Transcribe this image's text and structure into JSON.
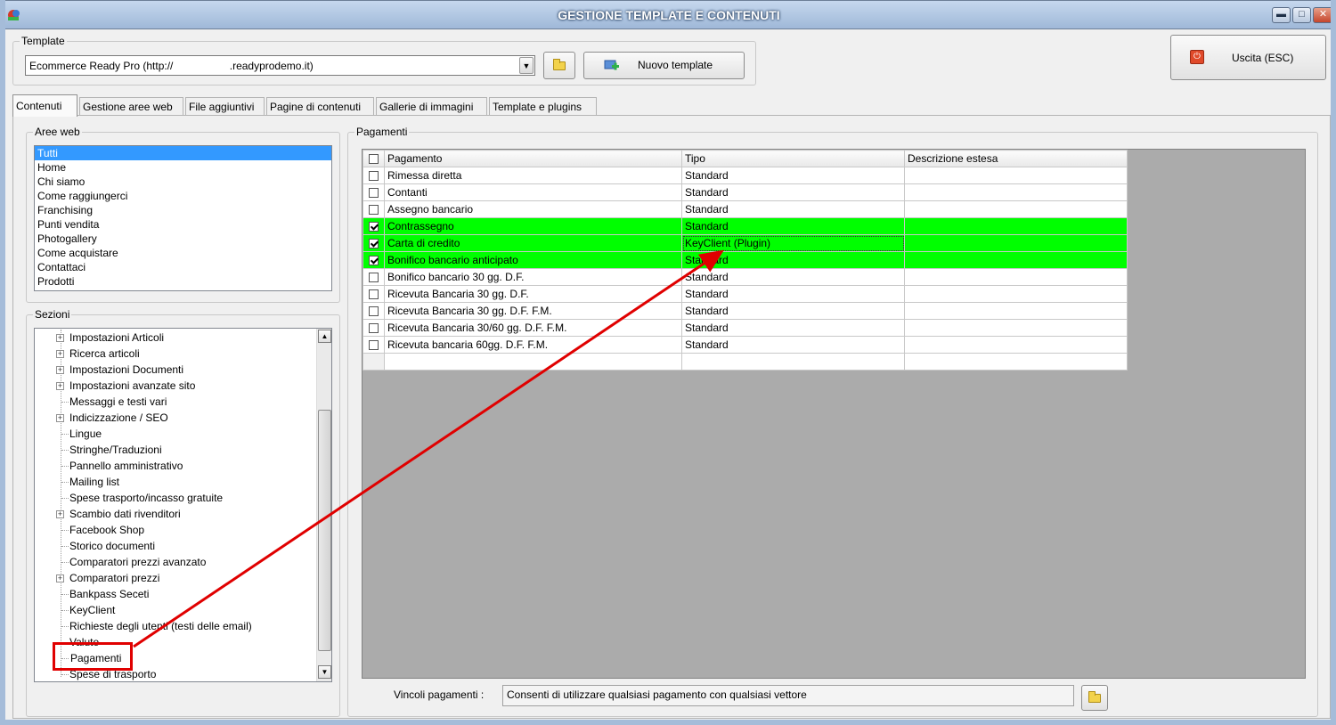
{
  "window": {
    "title": "GESTIONE TEMPLATE E CONTENUTI",
    "minimize": "▬",
    "maximize": "□",
    "close": "✕"
  },
  "template": {
    "group_label": "Template",
    "selected": "Ecommerce Ready Pro (http://                   .readyprodemo.it)",
    "new_button": "Nuovo template"
  },
  "exit_button": "Uscita (ESC)",
  "tabs": [
    {
      "label": "Contenuti",
      "active": true
    },
    {
      "label": "Gestione aree web"
    },
    {
      "label": "File aggiuntivi"
    },
    {
      "label": "Pagine di contenuti"
    },
    {
      "label": "Gallerie di immagini"
    },
    {
      "label": "Template e plugins"
    }
  ],
  "aree_web": {
    "label": "Aree web",
    "items": [
      "Tutti",
      "Home",
      "Chi siamo",
      "Come raggiungerci",
      "Franchising",
      "Punti vendita",
      "Photogallery",
      "Come acquistare",
      "Contattaci",
      "Prodotti"
    ],
    "selected_index": 0
  },
  "sezioni": {
    "label": "Sezioni",
    "items": [
      {
        "label": "Impostazioni Articoli",
        "expandable": true
      },
      {
        "label": "Ricerca articoli",
        "expandable": true
      },
      {
        "label": "Impostazioni Documenti",
        "expandable": true
      },
      {
        "label": "Impostazioni avanzate sito",
        "expandable": true
      },
      {
        "label": "Messaggi e testi vari",
        "expandable": false
      },
      {
        "label": "Indicizzazione / SEO",
        "expandable": true
      },
      {
        "label": "Lingue",
        "expandable": false
      },
      {
        "label": "Stringhe/Traduzioni",
        "expandable": false
      },
      {
        "label": "Pannello amministrativo",
        "expandable": false
      },
      {
        "label": "Mailing list",
        "expandable": false
      },
      {
        "label": "Spese trasporto/incasso gratuite",
        "expandable": false
      },
      {
        "label": "Scambio dati rivenditori",
        "expandable": true
      },
      {
        "label": "Facebook Shop",
        "expandable": false
      },
      {
        "label": "Storico documenti",
        "expandable": false
      },
      {
        "label": "Comparatori prezzi avanzato",
        "expandable": false
      },
      {
        "label": "Comparatori prezzi",
        "expandable": true
      },
      {
        "label": "Bankpass Seceti",
        "expandable": false
      },
      {
        "label": "KeyClient",
        "expandable": false
      },
      {
        "label": "Richieste degli utenti (testi delle email)",
        "expandable": false
      },
      {
        "label": "Valute",
        "expandable": false
      },
      {
        "label": "Pagamenti",
        "expandable": false,
        "highlighted": true
      },
      {
        "label": "Spese di trasporto",
        "expandable": false
      }
    ]
  },
  "pagamenti": {
    "label": "Pagamenti",
    "columns": [
      "Pagamento",
      "Tipo",
      "Descrizione estesa"
    ],
    "rows": [
      {
        "pagamento": "Rimessa diretta",
        "tipo": "Standard",
        "descrizione": "",
        "checked": false
      },
      {
        "pagamento": "Contanti",
        "tipo": "Standard",
        "descrizione": "",
        "checked": false
      },
      {
        "pagamento": "Assegno bancario",
        "tipo": "Standard",
        "descrizione": "",
        "checked": false
      },
      {
        "pagamento": "Contrassegno",
        "tipo": "Standard",
        "descrizione": "",
        "checked": true
      },
      {
        "pagamento": "Carta di credito",
        "tipo": "KeyClient (Plugin)",
        "descrizione": "",
        "checked": true
      },
      {
        "pagamento": "Bonifico bancario anticipato",
        "tipo": "Standard",
        "descrizione": "",
        "checked": true
      },
      {
        "pagamento": "Bonifico bancario 30 gg. D.F.",
        "tipo": "Standard",
        "descrizione": "",
        "checked": false
      },
      {
        "pagamento": "Ricevuta Bancaria 30 gg. D.F.",
        "tipo": "Standard",
        "descrizione": "",
        "checked": false
      },
      {
        "pagamento": "Ricevuta Bancaria 30 gg. D.F. F.M.",
        "tipo": "Standard",
        "descrizione": "",
        "checked": false
      },
      {
        "pagamento": "Ricevuta Bancaria 30/60 gg. D.F. F.M.",
        "tipo": "Standard",
        "descrizione": "",
        "checked": false
      },
      {
        "pagamento": "Ricevuta bancaria 60gg. D.F. F.M.",
        "tipo": "Standard",
        "descrizione": "",
        "checked": false
      }
    ],
    "vincoli_label": "Vincoli pagamenti :",
    "vincoli_value": "Consenti di utilizzare qualsiasi pagamento con qualsiasi vettore"
  },
  "colors": {
    "selection": "#3399ff",
    "active_row": "#00ff00",
    "annotation": "#e00000",
    "grid_background": "#ababab"
  }
}
